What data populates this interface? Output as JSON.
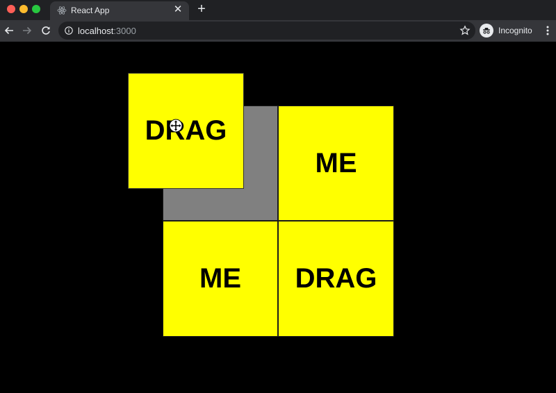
{
  "browser": {
    "tab": {
      "title": "React App",
      "close_label": "✕"
    },
    "new_tab_label": "+",
    "address": {
      "host": "localhost",
      "port": ":3000"
    },
    "profile_label": "Incognito"
  },
  "board": {
    "dragging_item": {
      "label": "DRAG"
    },
    "cells": [
      {
        "label": "",
        "state": "empty-drop-target"
      },
      {
        "label": "ME",
        "state": "filled"
      },
      {
        "label": "ME",
        "state": "filled"
      },
      {
        "label": "DRAG",
        "state": "filled"
      }
    ]
  },
  "colors": {
    "tile": "#ffff00",
    "empty_cell": "#808080",
    "background": "#000000"
  },
  "cursor": "move-cursor-icon"
}
